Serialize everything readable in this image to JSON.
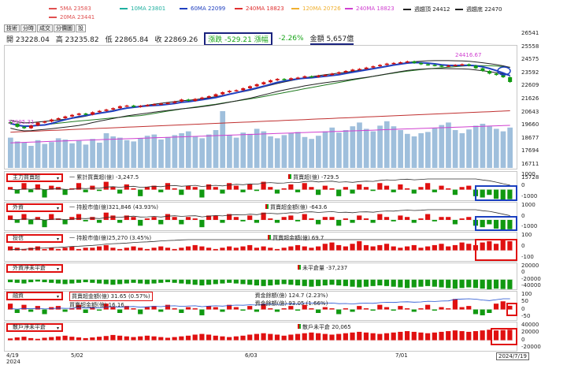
{
  "legend": {
    "items": [
      {
        "label": "5MA 23583",
        "color": "#e05050"
      },
      {
        "label": "10MA 23801",
        "color": "#20b0a0"
      },
      {
        "label": "60MA 22099",
        "color": "#2040c0"
      },
      {
        "label": "240MA 18823",
        "color": "#e03030"
      },
      {
        "label": "120MA 20726",
        "color": "#f0b030"
      },
      {
        "label": "240MA 18823",
        "color": "#d040d0"
      },
      {
        "label": "週趨頂 24412",
        "color": "#222222"
      },
      {
        "label": "週趨底 22470",
        "color": "#222222"
      },
      {
        "label": "20MA 23441",
        "color": "#e05050"
      }
    ]
  },
  "tabs": [
    "技術",
    "分時",
    "成交",
    "分價圖",
    "設"
  ],
  "ohlc": {
    "open": "開 23228.04",
    "high": "高 23235.82",
    "low": "低 22865.84",
    "close": "收 22869.26",
    "change": "漲跌 -529.21",
    "amp_label": "漲幅",
    "pct": "-2.26%",
    "amount": "金額 5,657億"
  },
  "price_axis": [
    "26541",
    "25558",
    "24575",
    "23592",
    "22609",
    "21626",
    "20643",
    "19660",
    "18677",
    "17694",
    "16711",
    "15728"
  ],
  "annotations": {
    "peak": "24416.67",
    "low": "19395.31"
  },
  "subpanels": [
    {
      "select": "主力買賣超",
      "items": [
        "一 累計買賣超(億) -3,247.5",
        "買賣超(億) -729.5"
      ],
      "axis": [
        "1000",
        "0",
        "-1000"
      ]
    },
    {
      "select": "外資",
      "items": [
        "一 持股市值(億)321,846 (43.93%)",
        "買賣超金額(億) -643.6"
      ],
      "axis": [
        "1000",
        "0",
        "-1000"
      ]
    },
    {
      "select": "投信",
      "items": [
        "一 持股市值(億)25,270 (3.45%)",
        "買賣超金額(億) 69.7"
      ],
      "axis": [
        "100",
        "0",
        "-100"
      ]
    },
    {
      "select": "外資淨未平倉",
      "items": [
        "未平倉量 -37,237"
      ],
      "axis": [
        "20000",
        "0",
        "-20000",
        "-40000"
      ]
    },
    {
      "select": "融資",
      "items": [
        "買賣超金額(億) 31.65 (0.57%)",
        "資金餘額(億) 124.7 (2.23%)",
        "買賣超金額(億) 16.16",
        "資金餘額(億) 93.05 (1.66%)"
      ],
      "axis": [
        "100",
        "50",
        "0",
        "-50"
      ]
    },
    {
      "select": "散戶淨未平倉",
      "items": [
        "散戶未平倉 20,065"
      ],
      "axis": [
        "40000",
        "20000",
        "0",
        "-20000"
      ]
    }
  ],
  "xaxis": [
    "4/19",
    "2024",
    "5/02",
    "6/03",
    "7/01",
    "2024/7/19"
  ],
  "chart_data": {
    "type": "bar",
    "title": "",
    "xlabel": "",
    "ylabel": "",
    "candles_ohlc_last": {
      "open": 23228.04,
      "high": 23235.82,
      "low": 22865.84,
      "close": 22869.26
    },
    "price_ylim": [
      15728,
      26541
    ],
    "volume_relative": [
      0.48,
      0.42,
      0.4,
      0.35,
      0.44,
      0.38,
      0.41,
      0.47,
      0.45,
      0.39,
      0.43,
      0.37,
      0.46,
      0.4,
      0.55,
      0.5,
      0.48,
      0.44,
      0.42,
      0.47,
      0.51,
      0.53,
      0.45,
      0.49,
      0.52,
      0.55,
      0.58,
      0.5,
      0.47,
      0.53,
      0.6,
      0.9,
      0.52,
      0.48,
      0.56,
      0.54,
      0.62,
      0.58,
      0.5,
      0.47,
      0.52,
      0.55,
      0.57,
      0.49,
      0.46,
      0.51,
      0.58,
      0.64,
      0.56,
      0.6,
      0.66,
      0.72,
      0.62,
      0.58,
      0.67,
      0.74,
      0.66,
      0.6,
      0.54,
      0.5,
      0.55,
      0.57,
      0.63,
      0.68,
      0.72,
      0.6,
      0.55,
      0.61,
      0.67,
      0.7,
      0.66,
      0.62,
      0.58,
      0.64,
      0.7
    ],
    "close_series": [
      19750,
      19500,
      19395.31,
      19600,
      19820,
      19900,
      20050,
      20150,
      20280,
      20400,
      20500,
      20420,
      20600,
      20700,
      20800,
      20900,
      21050,
      21100,
      21000,
      21080,
      21150,
      21200,
      21250,
      21300,
      21400,
      21550,
      21450,
      21600,
      21700,
      21800,
      21950,
      22100,
      22200,
      22250,
      22400,
      22550,
      22700,
      22850,
      23000,
      23100,
      23050,
      23150,
      23200,
      23300,
      23250,
      23350,
      23400,
      23500,
      23600,
      23700,
      23800,
      23850,
      23950,
      24050,
      24150,
      24250,
      24300,
      24350,
      24416.67,
      24300,
      24200,
      24150,
      24100,
      24050,
      24100,
      24150,
      24200,
      24100,
      23900,
      23700,
      23500,
      23398,
      23228,
      22869.26
    ],
    "series": [
      {
        "name": "主力買賣超",
        "values": [
          2,
          -3,
          5,
          -2,
          4,
          -6,
          3,
          2,
          -4,
          1,
          5,
          -2,
          3,
          -1,
          6,
          2,
          -3,
          4,
          1,
          -5,
          2,
          3,
          -2,
          5,
          1,
          -4,
          3,
          2,
          -6,
          4,
          2,
          -3,
          5,
          3,
          -2,
          4,
          -1,
          6,
          2,
          -3,
          1,
          4,
          -2,
          5,
          2,
          -4,
          3,
          1,
          -5,
          2,
          -3,
          4,
          2,
          -1,
          5,
          3,
          -2,
          4,
          1,
          -3,
          2,
          5,
          -2,
          3,
          1,
          -4,
          2,
          3,
          -5,
          -6,
          -4,
          -7,
          -8,
          -7.3
        ]
      },
      {
        "name": "外資",
        "values": [
          3,
          -2,
          4,
          -3,
          2,
          -5,
          4,
          1,
          -3,
          2,
          4,
          -1,
          2,
          -2,
          5,
          3,
          -2,
          3,
          2,
          -4,
          1,
          2,
          -3,
          4,
          2,
          -3,
          2,
          1,
          -5,
          3,
          3,
          -2,
          4,
          2,
          -1,
          3,
          -2,
          5,
          1,
          -2,
          2,
          3,
          -1,
          4,
          1,
          -3,
          2,
          2,
          -4,
          1,
          -2,
          3,
          1,
          -2,
          4,
          2,
          -1,
          3,
          2,
          -2,
          1,
          4,
          -1,
          2,
          2,
          -3,
          1,
          2,
          -4,
          -5,
          -3,
          -6,
          -7,
          -6.4
        ]
      },
      {
        "name": "投信",
        "values": [
          3,
          2,
          1,
          2,
          3,
          1,
          2,
          1,
          2,
          3,
          1,
          2,
          2,
          3,
          4,
          2,
          1,
          2,
          3,
          2,
          1,
          2,
          3,
          2,
          1,
          2,
          3,
          4,
          3,
          2,
          1,
          2,
          3,
          2,
          3,
          4,
          2,
          3,
          2,
          1,
          2,
          3,
          4,
          3,
          2,
          3,
          5,
          6,
          4,
          3,
          5,
          7,
          4,
          3,
          4,
          5,
          3,
          2,
          3,
          4,
          2,
          3,
          4,
          5,
          3,
          4,
          6,
          5,
          4,
          6,
          7,
          5,
          8,
          6.97
        ]
      },
      {
        "name": "外資淨未平倉",
        "values": [
          -2,
          -2.5,
          -3,
          -2,
          -1.5,
          -2,
          -2.5,
          -3,
          -3.5,
          -3,
          -2.5,
          -2,
          -2.5,
          -3,
          -3.5,
          -4,
          -3.5,
          -3,
          -2.5,
          -3,
          -3.5,
          -3,
          -2.5,
          -2,
          -2.5,
          -3,
          -3.5,
          -4,
          -4.5,
          -4,
          -3.5,
          -3,
          -2.5,
          -3,
          -3.5,
          -4,
          -4.5,
          -5,
          -4.5,
          -4,
          -3.5,
          -4,
          -4.5,
          -5,
          -5.5,
          -5,
          -4.5,
          -4,
          -4.5,
          -5,
          -5.5,
          -6,
          -5.5,
          -5,
          -4.5,
          -5,
          -5.5,
          -6,
          -6.5,
          -6,
          -5.5,
          -5,
          -5.5,
          -6,
          -6.5,
          -7,
          -6.5,
          -6,
          -6.5,
          -7,
          -7.5,
          -7,
          -7.3,
          -7.4
        ]
      },
      {
        "name": "融資",
        "values": [
          0.5,
          -0.3,
          0.4,
          -0.2,
          0.3,
          -0.4,
          0.2,
          0.3,
          -0.2,
          0.1,
          0.4,
          -0.3,
          0.2,
          -0.1,
          0.5,
          0.2,
          -0.3,
          0.3,
          0.1,
          -0.4,
          0.2,
          0.3,
          -0.2,
          0.4,
          0.1,
          -0.3,
          0.2,
          0.1,
          -0.5,
          0.3,
          0.2,
          -0.2,
          0.4,
          0.2,
          -0.1,
          0.3,
          -0.2,
          0.5,
          0.1,
          -0.2,
          0.1,
          0.3,
          -0.1,
          0.4,
          0.1,
          -0.3,
          0.2,
          0.1,
          -0.4,
          0.1,
          -0.2,
          0.3,
          0.1,
          -0.1,
          0.4,
          0.2,
          -0.1,
          0.3,
          0.1,
          -0.2,
          0.1,
          0.4,
          -0.1,
          0.2,
          0.1,
          0.9,
          0.2,
          0.3,
          -0.4,
          -0.5,
          -0.3,
          0.5,
          0.7,
          0.32
        ]
      },
      {
        "name": "散戶淨未平倉",
        "values": [
          0.5,
          0.8,
          1,
          0.6,
          0.4,
          0.7,
          0.9,
          1.1,
          1.3,
          1,
          0.8,
          0.6,
          0.8,
          1,
          1.2,
          1.5,
          1.3,
          1.1,
          0.9,
          1.1,
          1.3,
          1.1,
          0.9,
          0.7,
          0.9,
          1.1,
          1.3,
          1.6,
          1.8,
          1.6,
          1.3,
          1.1,
          0.9,
          1.1,
          1.3,
          1.6,
          1.8,
          2,
          1.8,
          1.6,
          1.3,
          1.6,
          1.8,
          2,
          2.2,
          2,
          1.8,
          1.6,
          1.8,
          2,
          2.2,
          2.4,
          2.2,
          2,
          1.8,
          2,
          2.2,
          2.4,
          2.6,
          2.4,
          2.2,
          2,
          2.2,
          2.4,
          2.6,
          2.8,
          2.6,
          2.4,
          2.6,
          2.8,
          3,
          2.8,
          2.9,
          3.0
        ]
      }
    ]
  }
}
